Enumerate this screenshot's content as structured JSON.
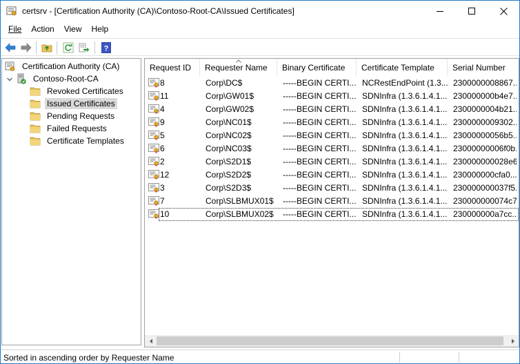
{
  "window": {
    "title": "certsrv - [Certification Authority (CA)\\Contoso-Root-CA\\Issued Certificates]"
  },
  "menu": [
    "File",
    "Action",
    "View",
    "Help"
  ],
  "toolbar": {
    "icons": [
      "back-arrow-icon",
      "forward-arrow-icon",
      "up-folder-icon",
      "refresh-icon",
      "export-list-icon",
      "help-icon"
    ]
  },
  "tree": {
    "root": "Certification Authority (CA)",
    "ca": "Contoso-Root-CA",
    "folders": [
      "Revoked Certificates",
      "Issued Certificates",
      "Pending Requests",
      "Failed Requests",
      "Certificate Templates"
    ],
    "selected_index": 1
  },
  "list": {
    "columns": [
      "Request ID",
      "Requester Name",
      "Binary Certificate",
      "Certificate Template",
      "Serial Number"
    ],
    "sorted_column": "Requester Name",
    "rows": [
      {
        "id": "8",
        "requester": "Corp\\DC$",
        "binary": "-----BEGIN CERTI...",
        "template": "NCRestEndPoint (1.3...",
        "serial": "2300000008867..."
      },
      {
        "id": "11",
        "requester": "Corp\\GW01$",
        "binary": "-----BEGIN CERTI...",
        "template": "SDNInfra (1.3.6.1.4.1...",
        "serial": "230000000b4e7..."
      },
      {
        "id": "4",
        "requester": "Corp\\GW02$",
        "binary": "-----BEGIN CERTI...",
        "template": "SDNInfra (1.3.6.1.4.1...",
        "serial": "2300000004b21..."
      },
      {
        "id": "9",
        "requester": "Corp\\NC01$",
        "binary": "-----BEGIN CERTI...",
        "template": "SDNInfra (1.3.6.1.4.1...",
        "serial": "2300000009302..."
      },
      {
        "id": "5",
        "requester": "Corp\\NC02$",
        "binary": "-----BEGIN CERTI...",
        "template": "SDNInfra (1.3.6.1.4.1...",
        "serial": "23000000056b5..."
      },
      {
        "id": "6",
        "requester": "Corp\\NC03$",
        "binary": "-----BEGIN CERTI...",
        "template": "SDNInfra (1.3.6.1.4.1...",
        "serial": "23000000006f0b..."
      },
      {
        "id": "2",
        "requester": "Corp\\S2D1$",
        "binary": "-----BEGIN CERTI...",
        "template": "SDNInfra (1.3.6.1.4.1...",
        "serial": "230000000028e6..."
      },
      {
        "id": "12",
        "requester": "Corp\\S2D2$",
        "binary": "-----BEGIN CERTI...",
        "template": "SDNInfra (1.3.6.1.4.1...",
        "serial": "230000000cfa0..."
      },
      {
        "id": "3",
        "requester": "Corp\\S2D3$",
        "binary": "-----BEGIN CERTI...",
        "template": "SDNInfra (1.3.6.1.4.1...",
        "serial": "230000000037f5..."
      },
      {
        "id": "7",
        "requester": "Corp\\SLBMUX01$",
        "binary": "-----BEGIN CERTI...",
        "template": "SDNInfra (1.3.6.1.4.1...",
        "serial": "230000000074c7..."
      },
      {
        "id": "10",
        "requester": "Corp\\SLBMUX02$",
        "binary": "-----BEGIN CERTI...",
        "template": "SDNInfra (1.3.6.1.4.1...",
        "serial": "230000000a7cc..."
      }
    ],
    "focused_index": 10
  },
  "status": {
    "text": "Sorted in ascending order by Requester Name"
  },
  "colors": {
    "window_border": "#1f7bc8",
    "selection": "#d9d9d9",
    "folder": "#e8c25a",
    "scrollbar_thumb": "#cdcdcd"
  }
}
